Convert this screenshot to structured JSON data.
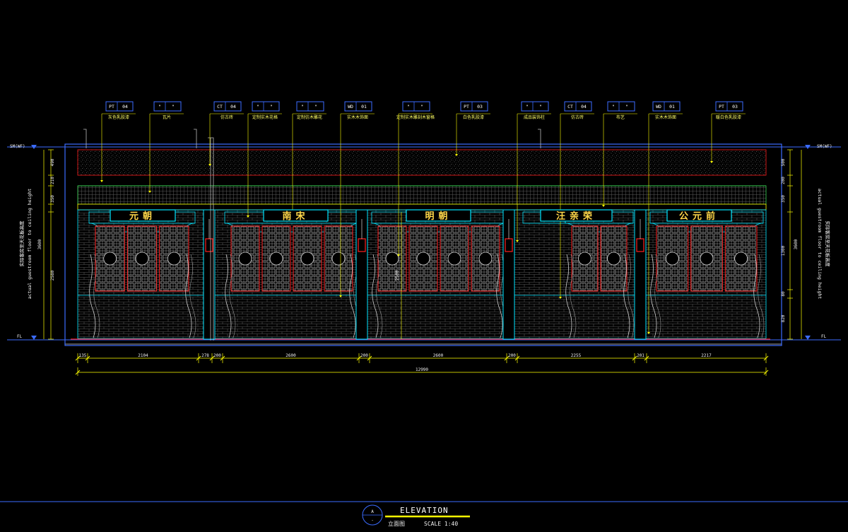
{
  "drawing": {
    "background": "#000000",
    "colors": {
      "yellow": "#ffff00",
      "cyan": "#00e5ff",
      "blue": "#3b6cff",
      "red": "#ff2020",
      "green": "#39d353",
      "white": "#ffffff",
      "magenta": "#ff2aff"
    }
  },
  "level_marks": {
    "top_left": "SM(WF)",
    "top_right": "SM(WF)",
    "bottom_left": "FL",
    "bottom_right": "FL"
  },
  "side_notes": {
    "left_cn": "实际客房至天花板高度",
    "left_en": "actual guestroom floor to ceiling height",
    "right_en": "actual guestroom floor to ceiling height",
    "right_cn": "实际客房至天花板高度"
  },
  "left_dims": [
    {
      "label": "490"
    },
    {
      "label": "210"
    },
    {
      "label": "350"
    },
    {
      "label": "3600"
    },
    {
      "label": "2580"
    }
  ],
  "right_dims": [
    {
      "label": "500"
    },
    {
      "label": "200"
    },
    {
      "label": "350"
    },
    {
      "label": "3600"
    },
    {
      "label": "1300"
    },
    {
      "label": "80"
    },
    {
      "label": "820"
    }
  ],
  "callouts": [
    {
      "code": "PT",
      "num": "04",
      "note": "灰色乳胶漆"
    },
    {
      "code": "\"",
      "num": "\"",
      "note": "瓦片"
    },
    {
      "code": "CT",
      "num": "04",
      "note": "仿古砖"
    },
    {
      "code": "\"",
      "num": "\"",
      "note": "定制实木花格"
    },
    {
      "code": "\"",
      "num": "\"",
      "note": "定制仿木雕花"
    },
    {
      "code": "WD",
      "num": "01",
      "note": "实木木饰面"
    },
    {
      "code": "\"",
      "num": "\"",
      "note": "定制实木雕刻木窗格"
    },
    {
      "code": "PT",
      "num": "03",
      "note": "白色乳胶漆"
    },
    {
      "code": "\"",
      "num": "\"",
      "note": "成品装饰柱"
    },
    {
      "code": "CT",
      "num": "04",
      "note": "仿古砖"
    },
    {
      "code": "\"",
      "num": "\"",
      "note": "布艺"
    },
    {
      "code": "WD",
      "num": "01",
      "note": "实木木饰面"
    },
    {
      "code": "PT",
      "num": "03",
      "note": "暖白色乳胶漆"
    }
  ],
  "signboards": [
    "元朝",
    "南宋",
    "明朝",
    "汪亲荣",
    "公元前"
  ],
  "inner_dim": "2500",
  "bottom_dims": [
    "135",
    "2104",
    "278",
    "200",
    "2600",
    "200",
    "2600",
    "200",
    "2255",
    "201",
    "2217"
  ],
  "total_dim": "12990",
  "title_block": {
    "marker_top": "A",
    "marker_bottom": "-",
    "title": "ELEVATION",
    "subtitle_cn": "立面图",
    "scale": "SCALE 1:40"
  }
}
